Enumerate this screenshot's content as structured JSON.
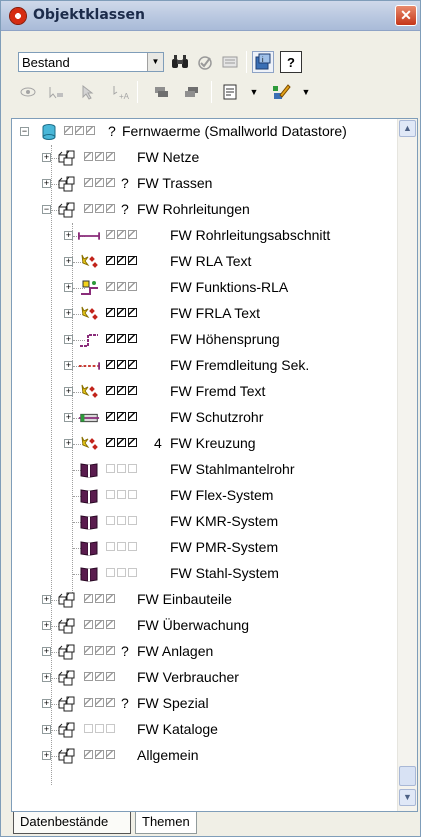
{
  "window": {
    "title": "Objektklassen",
    "close_glyph": "✕"
  },
  "toolbar": {
    "dataset_select": {
      "value": "Bestand"
    }
  },
  "tree": {
    "root": {
      "prefix": "?",
      "label": "Fernwaerme (Smallworld Datastore)"
    },
    "items": [
      {
        "q": "",
        "label": "FW Netze"
      },
      {
        "q": "?",
        "label": "FW Trassen"
      },
      {
        "q": "?",
        "label": "FW Rohrleitungen"
      },
      {
        "q": "",
        "label": "FW Rohrleitungsabschnitt"
      },
      {
        "q": "",
        "label": "FW RLA Text"
      },
      {
        "q": "",
        "label": "FW Funktions-RLA"
      },
      {
        "q": "",
        "label": "FW FRLA Text"
      },
      {
        "q": "",
        "label": "FW Höhensprung"
      },
      {
        "q": "",
        "label": "FW Fremdleitung Sek."
      },
      {
        "q": "",
        "label": "FW Fremd Text"
      },
      {
        "q": "",
        "label": "FW Schutzrohr"
      },
      {
        "q": "4",
        "label": "FW Kreuzung"
      },
      {
        "q": "",
        "label": "FW Stahlmantelrohr"
      },
      {
        "q": "",
        "label": "FW Flex-System"
      },
      {
        "q": "",
        "label": "FW KMR-System"
      },
      {
        "q": "",
        "label": "FW PMR-System"
      },
      {
        "q": "",
        "label": "FW Stahl-System"
      },
      {
        "q": "",
        "label": "FW Einbauteile"
      },
      {
        "q": "",
        "label": "FW Überwachung"
      },
      {
        "q": "?",
        "label": "FW Anlagen"
      },
      {
        "q": "",
        "label": "FW Verbraucher"
      },
      {
        "q": "?",
        "label": "FW Spezial"
      },
      {
        "q": "",
        "label": "FW Kataloge"
      },
      {
        "q": "",
        "label": "Allgemein"
      }
    ]
  },
  "tabs": [
    {
      "label": "Datenbestände"
    },
    {
      "label": "Themen"
    }
  ],
  "icons": {
    "group": "folder-objects-icon",
    "book": "catalog-book-icon",
    "binoculars": "binoculars-icon",
    "help": "help-icon"
  },
  "colors": {
    "title_bar": "#b7c6df",
    "close": "#c5361a",
    "link_line": "#8a2c7a",
    "text_icon": "#b8251e"
  }
}
